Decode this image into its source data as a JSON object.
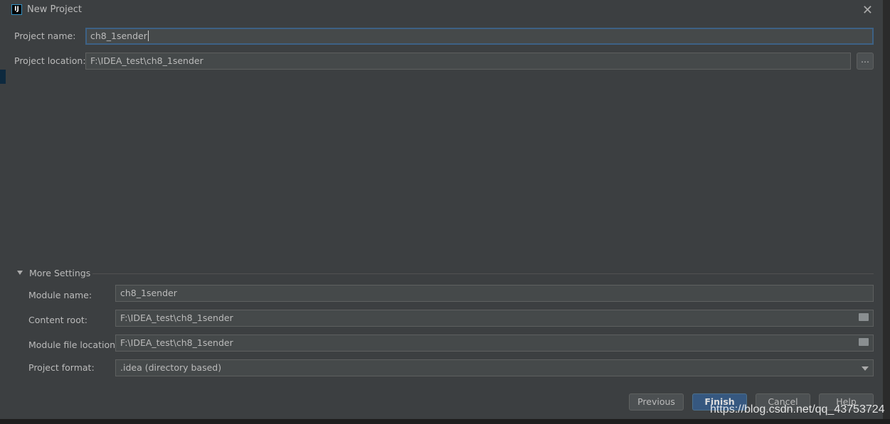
{
  "dialog": {
    "title": "New Project",
    "close_icon": "close-icon",
    "logo_text": "IJ"
  },
  "project": {
    "name_label": "Project name:",
    "name_value": "ch8_1sender",
    "location_label": "Project location:",
    "location_value": "F:\\IDEA_test\\ch8_1sender",
    "browse_label": "..."
  },
  "more_settings": {
    "title": "More Settings",
    "expanded": true,
    "module_name_label": "Module name:",
    "module_name_value": "ch8_1sender",
    "content_root_label": "Content root:",
    "content_root_value": "F:\\IDEA_test\\ch8_1sender",
    "module_file_label": "Module file location:",
    "module_file_value": "F:\\IDEA_test\\ch8_1sender",
    "format_label": "Project format:",
    "format_value": ".idea (directory based)"
  },
  "buttons": {
    "previous": "Previous",
    "finish": "Finish",
    "cancel": "Cancel",
    "help": "Help"
  },
  "watermark": "https://blog.csdn.net/qq_43753724",
  "colors": {
    "accent": "#365880",
    "focus_border": "#3d6185",
    "background": "#3c3f41"
  }
}
